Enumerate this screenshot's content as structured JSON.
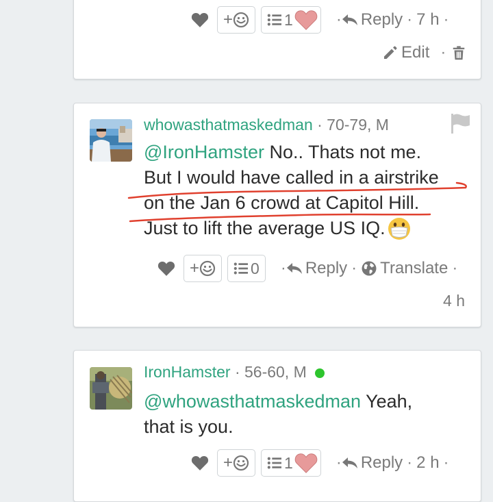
{
  "colors": {
    "accent": "#2fa37f",
    "online": "#2ec52e",
    "annotation": "#e0402e"
  },
  "comments": [
    {
      "actions": {
        "emoji_plus": "+",
        "list_count": "1",
        "reply": "Reply",
        "time": "7 h",
        "edit": "Edit"
      },
      "separators": {
        "dot": "·"
      }
    },
    {
      "username": "whowasthatmaskedman",
      "meta": "· 70-79, M",
      "mention": "@IronHamster",
      "line1_rest": "No.. Thats not me.",
      "line2": "But I would have called in a airstrike",
      "line3": "on the Jan 6 crowd at Capitol Hill.",
      "line4": "Just to lift the average US IQ.",
      "actions": {
        "emoji_plus": "+",
        "list_count": "0",
        "reply": "Reply",
        "translate": "Translate",
        "time": "4 h"
      },
      "separators": {
        "dot": "·"
      }
    },
    {
      "username": "IronHamster",
      "meta": "· 56-60, M",
      "mention": "@whowasthatmaskedman",
      "line1_rest": "Yeah,",
      "line2": "that is you.",
      "actions": {
        "emoji_plus": "+",
        "list_count": "1",
        "reply": "Reply",
        "time": "2 h"
      },
      "separators": {
        "dot": "·"
      }
    }
  ]
}
